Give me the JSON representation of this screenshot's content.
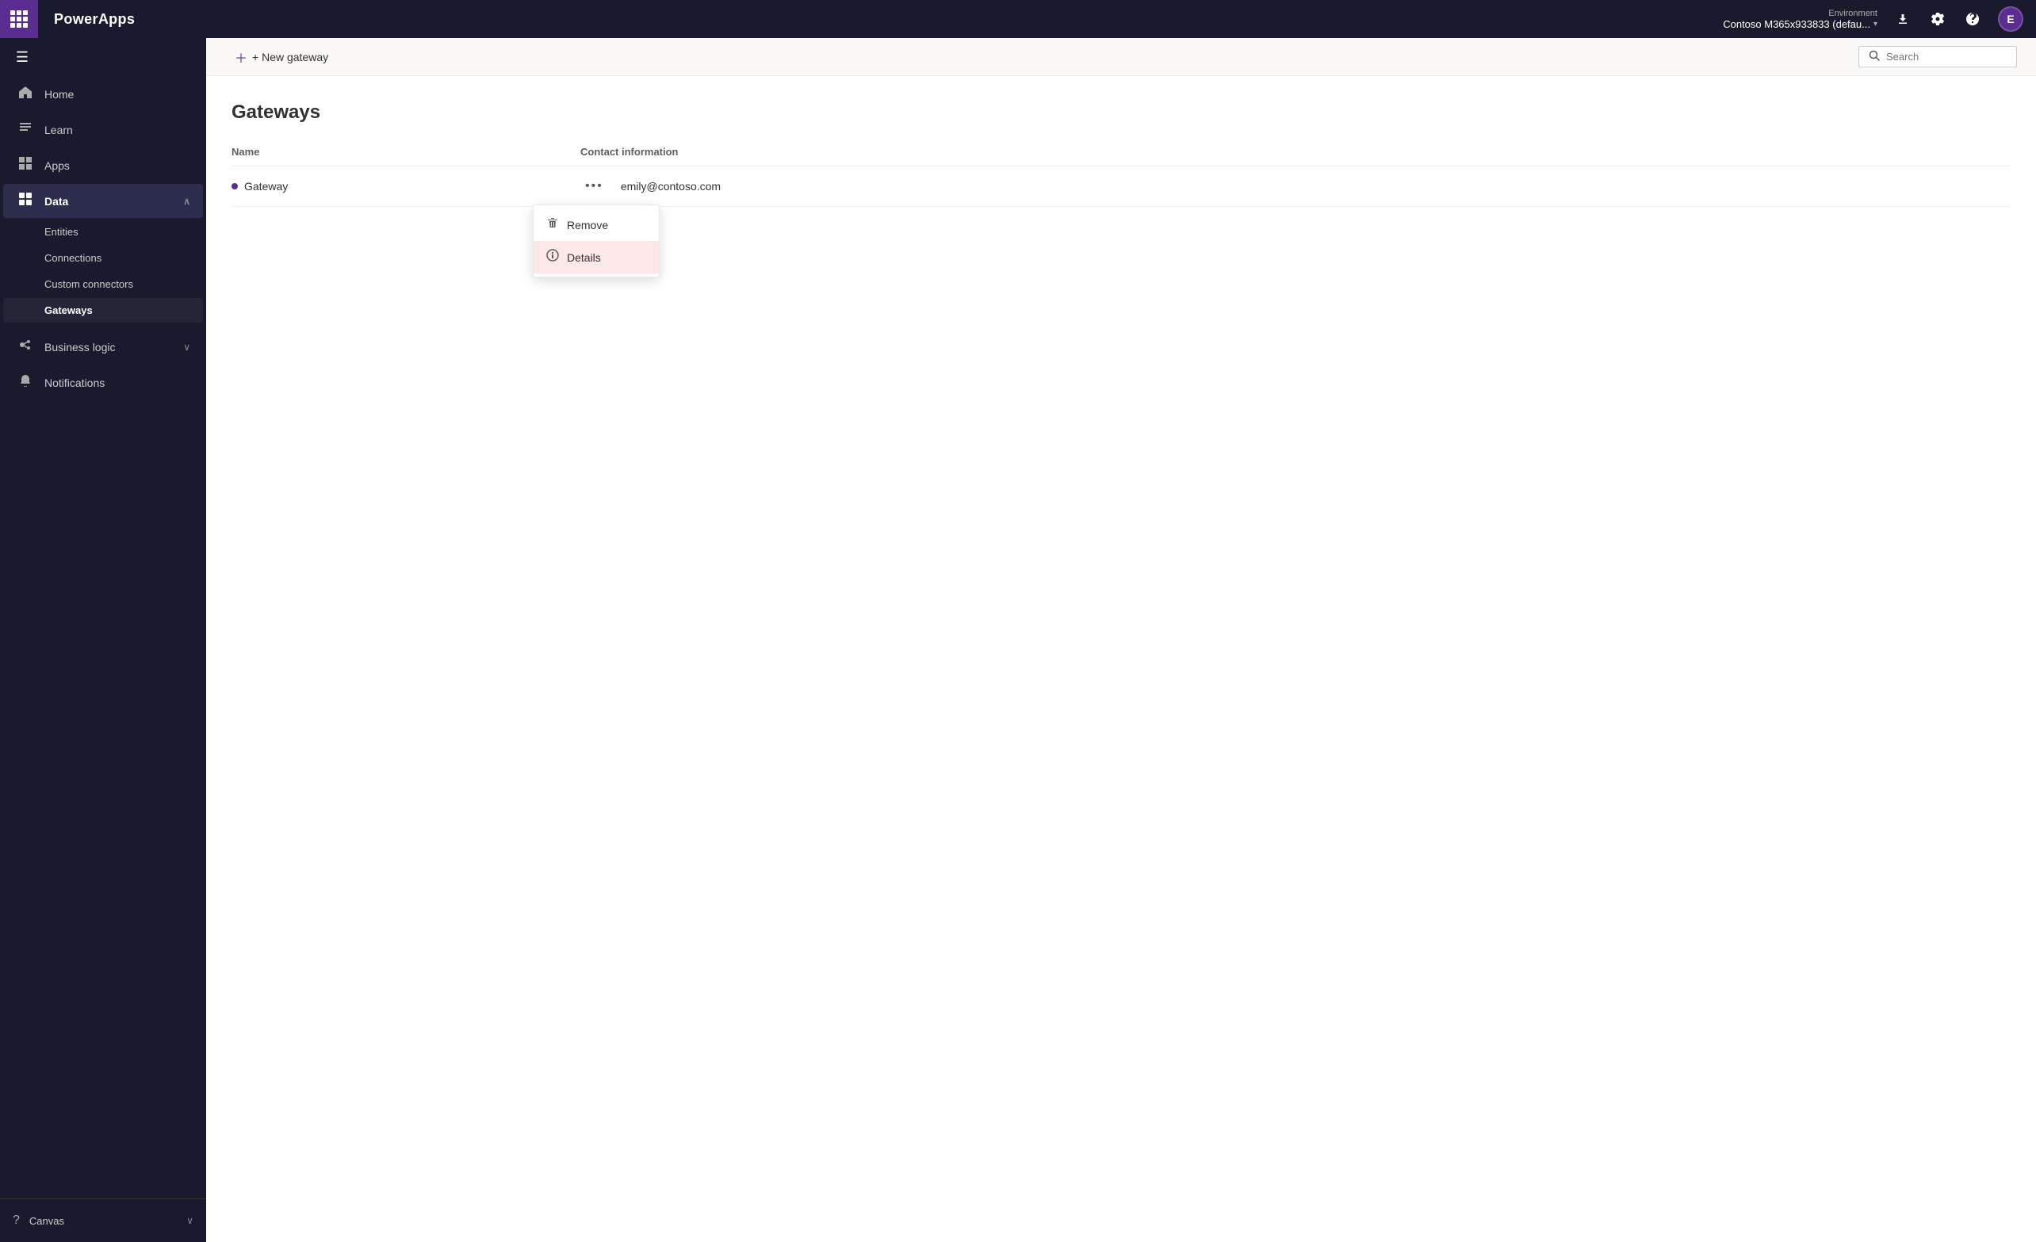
{
  "topbar": {
    "brand": "PowerApps",
    "env_label": "Environment",
    "env_name": "Contoso M365x933833 (defau...",
    "download_icon": "⬇",
    "settings_icon": "⚙",
    "help_icon": "?",
    "avatar_letter": "E"
  },
  "sidebar": {
    "hamburger_label": "☰",
    "items": [
      {
        "id": "home",
        "icon": "⌂",
        "label": "Home",
        "active": false
      },
      {
        "id": "learn",
        "icon": "📖",
        "label": "Learn",
        "active": false
      },
      {
        "id": "apps",
        "icon": "⊞",
        "label": "Apps",
        "active": false
      },
      {
        "id": "data",
        "icon": "⊡",
        "label": "Data",
        "active": true,
        "chevron": "∧"
      }
    ],
    "data_sub_items": [
      {
        "id": "entities",
        "label": "Entities",
        "active": false
      },
      {
        "id": "connections",
        "label": "Connections",
        "active": false
      },
      {
        "id": "custom-connectors",
        "label": "Custom connectors",
        "active": false
      },
      {
        "id": "gateways",
        "label": "Gateways",
        "active": true
      }
    ],
    "items_bottom": [
      {
        "id": "business-logic",
        "icon": "↗",
        "label": "Business logic",
        "active": false,
        "chevron": "∨"
      },
      {
        "id": "notifications",
        "icon": "🔔",
        "label": "Notifications",
        "active": false
      }
    ],
    "footer_item": {
      "icon": "?",
      "label": "Canvas"
    }
  },
  "toolbar": {
    "new_gateway_label": "+ New gateway",
    "search_placeholder": "Search"
  },
  "page": {
    "title": "Gateways",
    "table_col_name": "Name",
    "table_col_contact": "Contact information",
    "gateway_name": "Gateway",
    "gateway_email": "emily@contoso.com"
  },
  "context_menu": {
    "remove_label": "Remove",
    "details_label": "Details",
    "remove_icon": "🗑",
    "details_icon": "ℹ"
  }
}
